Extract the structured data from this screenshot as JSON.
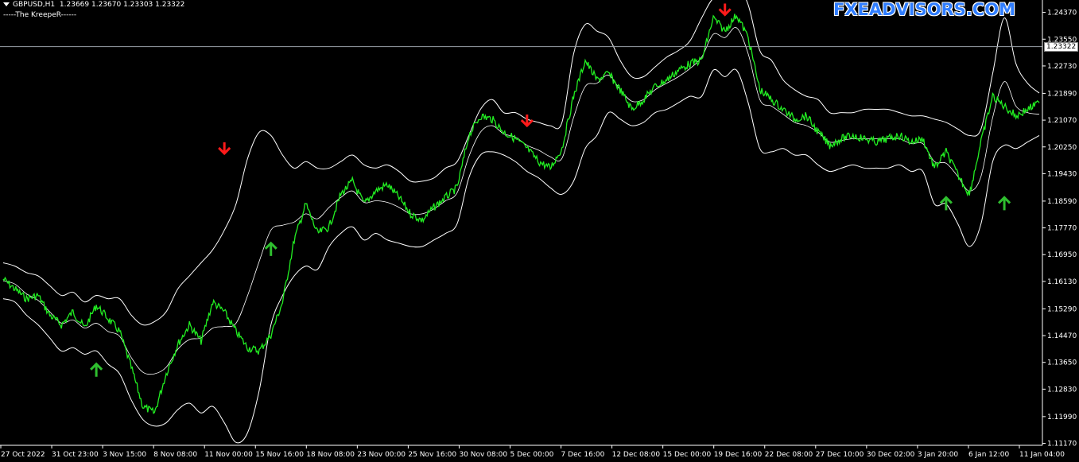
{
  "header": {
    "symbol": "GBPUSD,H1",
    "ohlc": "1.23669 1.23670 1.23303 1.23322",
    "indicator_label": "-----The KreepeR------"
  },
  "watermark": "FXEADVISORS.COM",
  "current_price": "1.23322",
  "colors": {
    "background": "#000000",
    "price": "#22ee22",
    "bands": "#ffffff",
    "sell_arrow": "#ff1a1a",
    "buy_arrow": "#2fbf2f",
    "watermark": "#2f7dff"
  },
  "chart_data": {
    "type": "line",
    "title": "",
    "xlabel": "",
    "ylabel": "",
    "ylim": [
      1.1111,
      1.2475
    ],
    "y_ticks": [
      "1.24370",
      "1.23550",
      "1.22730",
      "1.21890",
      "1.21070",
      "1.20250",
      "1.19430",
      "1.18590",
      "1.17770",
      "1.16950",
      "1.16130",
      "1.15290",
      "1.14470",
      "1.13650",
      "1.12830",
      "1.11990",
      "1.11170"
    ],
    "x_ticks": [
      "27 Oct 2022",
      "31 Oct 23:00",
      "3 Nov 15:00",
      "8 Nov 08:00",
      "11 Nov 00:00",
      "15 Nov 16:00",
      "18 Nov 08:00",
      "23 Nov 00:00",
      "25 Nov 16:00",
      "30 Nov 08:00",
      "5 Dec 00:00",
      "7 Dec 16:00",
      "12 Dec 08:00",
      "15 Dec 00:00",
      "19 Dec 16:00",
      "22 Dec 08:00",
      "27 Dec 10:00",
      "30 Dec 02:00",
      "3 Jan 20:00",
      "6 Jan 12:00",
      "11 Jan 04:00"
    ],
    "grid": false,
    "series": [
      {
        "name": "GBPUSD,H1",
        "values": [
          1.162,
          1.159,
          1.156,
          1.157,
          1.151,
          1.148,
          1.152,
          1.147,
          1.154,
          1.15,
          1.146,
          1.135,
          1.123,
          1.121,
          1.133,
          1.142,
          1.148,
          1.143,
          1.155,
          1.152,
          1.146,
          1.141,
          1.14,
          1.145,
          1.155,
          1.174,
          1.185,
          1.176,
          1.178,
          1.188,
          1.192,
          1.185,
          1.189,
          1.191,
          1.187,
          1.182,
          1.18,
          1.184,
          1.187,
          1.19,
          1.206,
          1.212,
          1.211,
          1.207,
          1.205,
          1.202,
          1.198,
          1.196,
          1.202,
          1.218,
          1.229,
          1.223,
          1.225,
          1.22,
          1.214,
          1.217,
          1.221,
          1.223,
          1.226,
          1.228,
          1.229,
          1.242,
          1.238,
          1.243,
          1.236,
          1.22,
          1.217,
          1.214,
          1.211,
          1.212,
          1.207,
          1.203,
          1.205,
          1.206,
          1.205,
          1.204,
          1.205,
          1.206,
          1.204,
          1.205,
          1.196,
          1.201,
          1.194,
          1.188,
          1.204,
          1.218,
          1.215,
          1.212,
          1.214,
          1.216
        ]
      },
      {
        "name": "",
        "values": [
          1.167,
          1.166,
          1.164,
          1.163,
          1.16,
          1.157,
          1.158,
          1.155,
          1.157,
          1.156,
          1.156,
          1.151,
          1.148,
          1.149,
          1.152,
          1.159,
          1.163,
          1.167,
          1.171,
          1.177,
          1.185,
          1.199,
          1.207,
          1.206,
          1.2,
          1.196,
          1.198,
          1.196,
          1.196,
          1.198,
          1.2,
          1.197,
          1.196,
          1.197,
          1.195,
          1.192,
          1.192,
          1.193,
          1.196,
          1.198,
          1.206,
          1.214,
          1.217,
          1.213,
          1.213,
          1.211,
          1.21,
          1.209,
          1.21,
          1.231,
          1.24,
          1.238,
          1.236,
          1.229,
          1.224,
          1.224,
          1.227,
          1.23,
          1.232,
          1.235,
          1.242,
          1.248,
          1.248,
          1.252,
          1.246,
          1.232,
          1.229,
          1.223,
          1.22,
          1.218,
          1.217,
          1.213,
          1.213,
          1.213,
          1.214,
          1.214,
          1.214,
          1.213,
          1.212,
          1.212,
          1.211,
          1.21,
          1.208,
          1.206,
          1.208,
          1.225,
          1.242,
          1.228,
          1.222,
          1.219
        ]
      },
      {
        "name": "",
        "values": [
          1.156,
          1.155,
          1.151,
          1.148,
          1.144,
          1.14,
          1.141,
          1.139,
          1.14,
          1.136,
          1.133,
          1.125,
          1.119,
          1.117,
          1.118,
          1.122,
          1.124,
          1.121,
          1.123,
          1.118,
          1.112,
          1.115,
          1.128,
          1.148,
          1.157,
          1.163,
          1.166,
          1.165,
          1.172,
          1.176,
          1.178,
          1.174,
          1.176,
          1.174,
          1.173,
          1.172,
          1.172,
          1.174,
          1.176,
          1.179,
          1.193,
          1.2,
          1.201,
          1.2,
          1.198,
          1.195,
          1.193,
          1.19,
          1.188,
          1.192,
          1.202,
          1.206,
          1.213,
          1.211,
          1.209,
          1.21,
          1.213,
          1.214,
          1.216,
          1.218,
          1.218,
          1.226,
          1.224,
          1.226,
          1.216,
          1.202,
          1.201,
          1.202,
          1.2,
          1.2,
          1.197,
          1.195,
          1.196,
          1.197,
          1.196,
          1.196,
          1.196,
          1.197,
          1.195,
          1.195,
          1.185,
          1.185,
          1.179,
          1.172,
          1.179,
          1.198,
          1.203,
          1.202,
          1.204,
          1.206
        ]
      }
    ],
    "signals": [
      {
        "type": "sell",
        "x_index": 19,
        "y": 1.2005
      },
      {
        "type": "sell",
        "x_index": 45,
        "y": 1.209
      },
      {
        "type": "sell",
        "x_index": 62,
        "y": 1.243
      },
      {
        "type": "buy",
        "x_index": 8,
        "y": 1.136
      },
      {
        "type": "buy",
        "x_index": 23,
        "y": 1.173
      },
      {
        "type": "buy",
        "x_index": 81,
        "y": 1.187
      },
      {
        "type": "buy",
        "x_index": 86,
        "y": 1.187
      }
    ]
  }
}
